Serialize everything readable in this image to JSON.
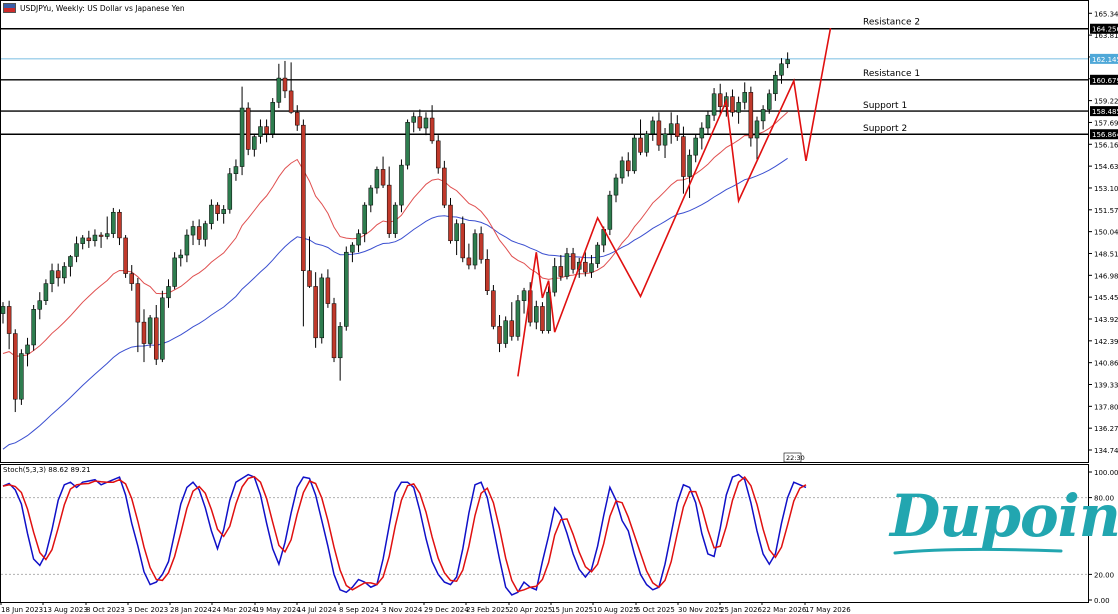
{
  "header": {
    "title": "USDJPYu, Weekly:  US Dollar vs Japanese Yen"
  },
  "price_axis": {
    "labels": [
      "165.340",
      "163.810",
      "162.280",
      "160.750",
      "159.220",
      "157.690",
      "156.160",
      "154.630",
      "153.100",
      "151.570",
      "150.040",
      "148.510",
      "146.980",
      "145.450",
      "143.920",
      "142.390",
      "140.860",
      "139.330",
      "137.800",
      "136.270",
      "134.740"
    ],
    "marker_price": "162.145",
    "marker_price_value": 162.145,
    "colors": {
      "current_price": "#4fa8d8",
      "level_line": "#000000"
    }
  },
  "levels": [
    {
      "name": "Resistance 2",
      "value": "164.256"
    },
    {
      "name": "Resistance 1",
      "value": "160.679"
    },
    {
      "name": "Support 1",
      "value": "158.485"
    },
    {
      "name": "Support 2",
      "value": "156.864"
    }
  ],
  "time_axis": {
    "labels": [
      "18 Jun 2023",
      "13 Aug 2023",
      "8 Oct 2023",
      "3 Dec 2023",
      "28 Jan 2024",
      "24 Mar 2024",
      "19 May 2024",
      "14 Jul 2024",
      "8 Sep 2024",
      "3 Nov 2024",
      "29 Dec 2024",
      "23 Feb 2025",
      "20 Apr 2025",
      "15 Jun 2025",
      "10 Aug 2025",
      "5 Oct 2025",
      "30 Nov 2025",
      "25 Jan 2026",
      "22 Mar 2026",
      "17 May 2026"
    ],
    "cursor_label": "22:30"
  },
  "indicator": {
    "label": "Stoch(5,3,3) 88.62 89.21",
    "levels": [
      "100.00",
      "80.00",
      "20.00",
      "0.00"
    ],
    "level_values": [
      100,
      80,
      20,
      0
    ]
  },
  "logo": {
    "text": "Dupoin",
    "color": "#22a6b0"
  },
  "chart_data": {
    "type": "candlestick",
    "symbol": "USDJPYu",
    "timeframe": "Weekly",
    "ylim": [
      133.9,
      166.2
    ],
    "colors": {
      "bull": "#2e7d4f",
      "bear": "#c0392b",
      "ma_fast": "#e05050",
      "ma_slow": "#3b4fd0",
      "zigzag": "#e01010",
      "stoch_main": "#1010c8",
      "stoch_signal": "#e01010"
    },
    "ohlc": [
      [
        144.3,
        145.1,
        143.6,
        144.8
      ],
      [
        144.8,
        145.2,
        141.8,
        142.9
      ],
      [
        142.9,
        143.2,
        137.4,
        138.3
      ],
      [
        138.3,
        141.8,
        137.9,
        141.5
      ],
      [
        141.5,
        142.6,
        140.6,
        142.1
      ],
      [
        142.1,
        144.9,
        141.7,
        144.6
      ],
      [
        144.6,
        145.8,
        143.9,
        145.2
      ],
      [
        145.2,
        146.7,
        144.9,
        146.4
      ],
      [
        146.4,
        147.8,
        145.8,
        147.3
      ],
      [
        147.3,
        147.8,
        146.2,
        146.8
      ],
      [
        146.8,
        147.9,
        146.4,
        147.6
      ],
      [
        147.6,
        148.4,
        146.9,
        148.3
      ],
      [
        148.3,
        149.7,
        147.9,
        149.2
      ],
      [
        149.2,
        149.8,
        148.8,
        149.6
      ],
      [
        149.6,
        150.1,
        148.9,
        149.4
      ],
      [
        149.4,
        150.2,
        149.0,
        149.8
      ],
      [
        149.8,
        150.0,
        148.9,
        149.7
      ],
      [
        149.7,
        151.1,
        149.5,
        149.9
      ],
      [
        149.9,
        151.7,
        149.6,
        151.4
      ],
      [
        151.4,
        151.6,
        149.1,
        149.6
      ],
      [
        149.6,
        149.8,
        146.8,
        147.1
      ],
      [
        147.1,
        147.7,
        145.9,
        146.4
      ],
      [
        146.4,
        146.8,
        141.6,
        143.7
      ],
      [
        143.7,
        144.6,
        140.9,
        142.2
      ],
      [
        142.2,
        144.2,
        141.9,
        144.0
      ],
      [
        144.0,
        144.9,
        140.7,
        141.1
      ],
      [
        141.1,
        145.9,
        140.9,
        145.4
      ],
      [
        145.4,
        146.7,
        144.7,
        146.2
      ],
      [
        146.2,
        148.6,
        146.0,
        148.2
      ],
      [
        148.2,
        148.8,
        147.6,
        148.4
      ],
      [
        148.4,
        150.2,
        147.9,
        149.8
      ],
      [
        149.8,
        150.8,
        149.1,
        150.4
      ],
      [
        150.4,
        150.9,
        149.1,
        149.5
      ],
      [
        149.5,
        150.8,
        149.0,
        150.6
      ],
      [
        150.6,
        152.3,
        150.2,
        151.9
      ],
      [
        151.9,
        152.1,
        150.8,
        151.3
      ],
      [
        151.3,
        151.9,
        150.6,
        151.6
      ],
      [
        151.6,
        154.5,
        151.3,
        154.1
      ],
      [
        154.1,
        155.1,
        153.6,
        154.6
      ],
      [
        154.6,
        160.2,
        154.0,
        158.7
      ],
      [
        158.7,
        159.1,
        155.4,
        155.8
      ],
      [
        155.8,
        156.9,
        155.3,
        156.7
      ],
      [
        156.7,
        157.9,
        156.2,
        157.4
      ],
      [
        157.4,
        157.9,
        156.3,
        156.9
      ],
      [
        156.9,
        159.4,
        156.6,
        159.1
      ],
      [
        159.1,
        161.8,
        158.7,
        160.8
      ],
      [
        160.8,
        162.0,
        159.4,
        159.9
      ],
      [
        159.9,
        161.9,
        158.3,
        158.4
      ],
      [
        158.4,
        158.9,
        157.1,
        157.5
      ],
      [
        157.5,
        157.9,
        143.4,
        147.3
      ],
      [
        147.3,
        149.7,
        146.1,
        146.2
      ],
      [
        146.2,
        147.2,
        141.9,
        142.6
      ],
      [
        142.6,
        147.1,
        142.2,
        146.8
      ],
      [
        146.8,
        147.4,
        144.7,
        145.0
      ],
      [
        145.0,
        145.4,
        140.9,
        141.2
      ],
      [
        141.2,
        143.7,
        139.6,
        143.4
      ],
      [
        143.4,
        149.0,
        143.1,
        148.6
      ],
      [
        148.6,
        149.3,
        147.9,
        149.1
      ],
      [
        149.1,
        150.2,
        148.6,
        149.9
      ],
      [
        149.9,
        152.1,
        149.3,
        151.9
      ],
      [
        151.9,
        153.3,
        151.4,
        153.1
      ],
      [
        153.1,
        154.6,
        152.7,
        154.4
      ],
      [
        154.4,
        155.3,
        153.1,
        153.3
      ],
      [
        153.3,
        154.6,
        149.6,
        149.9
      ],
      [
        149.9,
        152.1,
        149.6,
        151.9
      ],
      [
        151.9,
        155.1,
        151.4,
        154.7
      ],
      [
        154.7,
        157.9,
        154.4,
        157.7
      ],
      [
        157.7,
        158.4,
        157.0,
        158.1
      ],
      [
        158.1,
        158.6,
        157.1,
        157.3
      ],
      [
        157.3,
        158.4,
        156.8,
        158.0
      ],
      [
        158.0,
        158.9,
        156.2,
        156.4
      ],
      [
        156.4,
        156.8,
        154.1,
        154.5
      ],
      [
        154.5,
        155.0,
        151.7,
        151.9
      ],
      [
        151.9,
        152.4,
        149.2,
        149.4
      ],
      [
        149.4,
        150.9,
        148.4,
        150.6
      ],
      [
        150.6,
        151.1,
        147.9,
        148.2
      ],
      [
        148.2,
        149.2,
        147.4,
        147.7
      ],
      [
        147.7,
        150.2,
        147.4,
        149.9
      ],
      [
        149.9,
        150.4,
        147.8,
        148.1
      ],
      [
        148.1,
        148.8,
        145.6,
        145.9
      ],
      [
        145.9,
        146.3,
        143.2,
        143.4
      ],
      [
        143.4,
        144.2,
        141.6,
        142.2
      ],
      [
        142.2,
        144.1,
        141.9,
        143.8
      ],
      [
        143.8,
        145.1,
        142.4,
        142.7
      ],
      [
        142.7,
        145.6,
        142.4,
        145.2
      ],
      [
        145.2,
        146.1,
        144.3,
        145.9
      ],
      [
        145.9,
        146.5,
        143.4,
        143.7
      ],
      [
        143.7,
        145.2,
        143.2,
        144.8
      ],
      [
        144.8,
        145.1,
        142.9,
        143.1
      ],
      [
        143.1,
        146.2,
        142.9,
        145.8
      ],
      [
        145.8,
        148.2,
        145.5,
        147.6
      ],
      [
        147.6,
        148.4,
        146.6,
        146.9
      ],
      [
        146.9,
        148.9,
        146.7,
        148.5
      ],
      [
        148.5,
        148.9,
        147.1,
        147.4
      ],
      [
        147.4,
        148.2,
        146.8,
        147.9
      ],
      [
        147.9,
        148.6,
        146.9,
        147.2
      ],
      [
        147.2,
        148.4,
        146.8,
        147.8
      ],
      [
        147.8,
        149.3,
        147.5,
        149.1
      ],
      [
        149.1,
        150.4,
        148.6,
        150.2
      ],
      [
        150.2,
        152.9,
        149.8,
        152.6
      ],
      [
        152.6,
        154.1,
        152.1,
        153.8
      ],
      [
        153.8,
        155.3,
        153.4,
        155.0
      ],
      [
        155.0,
        155.6,
        153.9,
        154.3
      ],
      [
        154.3,
        156.9,
        154.1,
        156.6
      ],
      [
        156.6,
        157.9,
        155.4,
        155.6
      ],
      [
        155.6,
        157.1,
        155.3,
        156.9
      ],
      [
        156.9,
        158.1,
        156.4,
        157.8
      ],
      [
        157.8,
        158.4,
        155.7,
        156.1
      ],
      [
        156.1,
        157.3,
        155.2,
        156.9
      ],
      [
        156.9,
        158.4,
        156.2,
        157.6
      ],
      [
        157.6,
        158.2,
        156.4,
        156.7
      ],
      [
        156.7,
        157.4,
        152.7,
        153.9
      ],
      [
        153.9,
        155.8,
        152.4,
        155.4
      ],
      [
        155.4,
        156.9,
        154.9,
        156.6
      ],
      [
        156.6,
        157.7,
        155.8,
        157.3
      ],
      [
        157.3,
        158.5,
        156.9,
        158.2
      ],
      [
        158.2,
        160.1,
        157.8,
        159.7
      ],
      [
        159.7,
        160.4,
        158.3,
        158.8
      ],
      [
        158.8,
        159.8,
        158.1,
        159.5
      ],
      [
        159.5,
        160.0,
        158.1,
        158.4
      ],
      [
        158.4,
        159.5,
        157.6,
        159.1
      ],
      [
        159.1,
        160.5,
        158.6,
        159.8
      ],
      [
        159.8,
        160.2,
        156.0,
        156.6
      ],
      [
        156.6,
        158.1,
        155.1,
        157.8
      ],
      [
        157.8,
        158.9,
        157.2,
        158.6
      ],
      [
        158.6,
        160.0,
        158.3,
        159.7
      ],
      [
        159.7,
        161.3,
        159.2,
        161.0
      ],
      [
        161.0,
        162.2,
        160.4,
        161.8
      ],
      [
        161.8,
        162.6,
        161.5,
        162.1
      ]
    ],
    "ma_fast": [],
    "ma_slow": [],
    "zigzag": [
      [
        84,
        139.9
      ],
      [
        87,
        148.6
      ],
      [
        88,
        145.4
      ],
      [
        89,
        146.6
      ],
      [
        90,
        143.0
      ],
      [
        97,
        151.0
      ],
      [
        104,
        145.5
      ],
      [
        118,
        159.2
      ],
      [
        120,
        152.2
      ],
      [
        129,
        160.6
      ],
      [
        131,
        155.0
      ],
      [
        135,
        164.3
      ]
    ],
    "stoch_main": [
      89,
      91,
      86,
      75,
      52,
      32,
      27,
      36,
      55,
      78,
      90,
      92,
      88,
      92,
      93,
      94,
      90,
      92,
      94,
      96,
      82,
      60,
      42,
      22,
      12,
      14,
      20,
      30,
      52,
      75,
      88,
      92,
      86,
      72,
      54,
      40,
      55,
      78,
      92,
      95,
      98,
      96,
      82,
      60,
      40,
      28,
      45,
      68,
      88,
      96,
      95,
      82,
      62,
      42,
      20,
      8,
      6,
      10,
      16,
      14,
      10,
      12,
      32,
      58,
      84,
      92,
      92,
      88,
      70,
      48,
      30,
      20,
      14,
      12,
      18,
      40,
      68,
      90,
      92,
      80,
      56,
      32,
      10,
      4,
      6,
      14,
      10,
      8,
      30,
      50,
      72,
      66,
      52,
      36,
      24,
      18,
      24,
      42,
      66,
      88,
      78,
      62,
      54,
      36,
      20,
      12,
      8,
      10,
      28,
      52,
      76,
      90,
      88,
      76,
      52,
      36,
      34,
      56,
      82,
      96,
      98,
      94,
      76,
      54,
      36,
      28,
      36,
      60,
      80,
      92,
      90,
      88
    ],
    "stoch_signal": []
  }
}
